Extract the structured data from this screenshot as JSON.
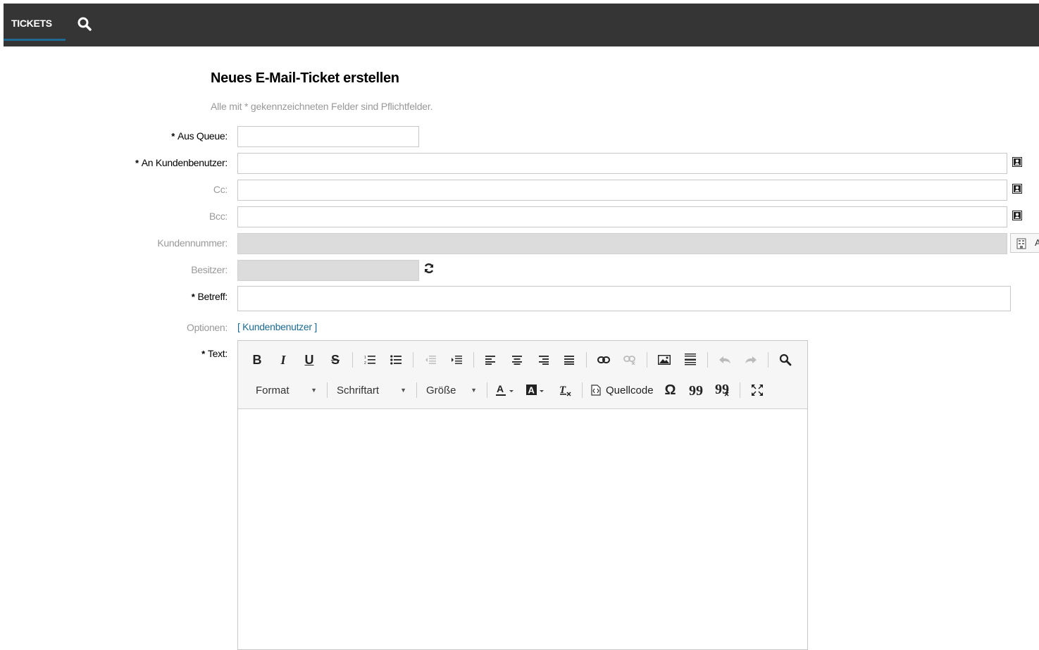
{
  "nav": {
    "tickets_label": "TICKETS"
  },
  "page": {
    "title": "Neues E-Mail-Ticket erstellen",
    "hint": "Alle mit * gekennzeichneten Felder sind Pflichtfelder."
  },
  "form": {
    "required_mark": "*",
    "queue_label": "Aus Queue:",
    "customer_user_label": "An Kundenbenutzer:",
    "cc_label": "Cc:",
    "bcc_label": "Bcc:",
    "customer_number_label": "Kundennummer:",
    "owner_label": "Besitzer:",
    "subject_label": "Betreff:",
    "options_label": "Optionen:",
    "options_link": "[ Kundenbenutzer ]",
    "text_label": "Text:",
    "customer_button_label": "A"
  },
  "editor": {
    "format_label": "Format",
    "font_label": "Schriftart",
    "size_label": "Größe",
    "source_label": "Quellcode"
  },
  "colors": {
    "topbar": "#353535",
    "accent": "#1d6a93",
    "muted": "#999999"
  }
}
